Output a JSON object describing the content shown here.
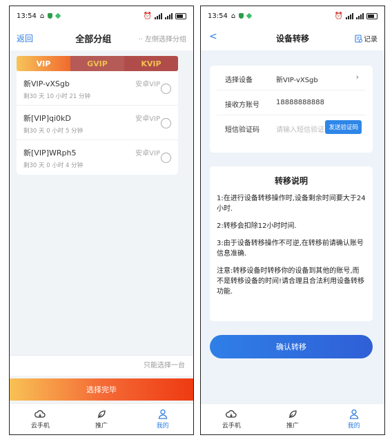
{
  "status": {
    "time": "13:54",
    "carrier1": "5G",
    "carrier2": "5G"
  },
  "left": {
    "header": {
      "back": "返回",
      "title": "全部分组",
      "hint": "左侧选择分组"
    },
    "tabs": [
      {
        "label": "VIP",
        "active": true
      },
      {
        "label": "GVIP",
        "active": false
      },
      {
        "label": "KVIP",
        "active": false
      }
    ],
    "devices": [
      {
        "name": "新VIP-vXSgb",
        "remaining": "剩30 天 10 小时 21 分钟",
        "type": "安卓VIP"
      },
      {
        "name": "新[VIP]qi0kD",
        "remaining": "剩30 天 0 小时 5 分钟",
        "type": "安卓VIP"
      },
      {
        "name": "新[VIP]WRph5",
        "remaining": "剩30 天 0 小时 4 分钟",
        "type": "安卓VIP"
      }
    ],
    "only_one": "只能选择一台",
    "done_button": "选择完毕"
  },
  "right": {
    "header": {
      "back": "<",
      "title": "设备转移",
      "record": "记录"
    },
    "form": {
      "device_label": "选择设备",
      "device_value": "新VIP-vXSgb",
      "account_label": "接收方账号",
      "account_value": "18888888888",
      "sms_label": "短信验证码",
      "sms_placeholder": "请输入短信验证码",
      "sms_button": "发送验证码"
    },
    "info": {
      "title": "转移说明",
      "p1": "1:在进行设备转移操作时,设备剩余时间要大于24小时.",
      "p2": "2:转移会扣除12小时时间.",
      "p3": "3:由于设备转移操作不可逆,在转移前请确认账号信息准确.",
      "p4": "注意:转移设备时转移你的设备到其他的账号,而不是转移设备的时间!请合理且合法利用设备转移功能."
    },
    "confirm_button": "确认转移"
  },
  "nav": {
    "items": [
      {
        "label": "云手机",
        "icon": "cloud-phone-icon"
      },
      {
        "label": "推广",
        "icon": "leaf-icon"
      },
      {
        "label": "我的",
        "icon": "user-icon",
        "active": true
      }
    ]
  },
  "colors": {
    "accent": "#2f7de1",
    "orange": "#f46b36",
    "tab_red": "#b04d4a"
  }
}
